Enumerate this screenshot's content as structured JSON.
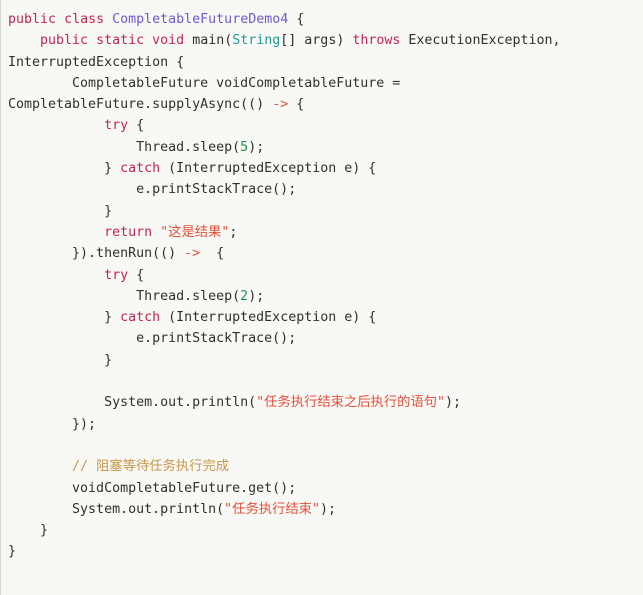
{
  "editor": {
    "language": "java",
    "background_color": "#f8f8f5",
    "left_border_color": "#d6d6d0",
    "default_text_color": "#303030",
    "font_size_px": 13.3,
    "line_height_px": 21.3
  },
  "syntax_colors": {
    "keyword": "#c7254e",
    "class_name": "#7158d6",
    "type": "#1f9e95",
    "number": "#1a9850",
    "string": "#e8503a",
    "comment": "#c8984b",
    "arrow": "#e8503a",
    "plain": "#303030"
  },
  "code": {
    "title": "CompletableFutureDemo4",
    "lines": [
      {
        "n": 1,
        "tokens": [
          {
            "t": "public",
            "c": "kw"
          },
          {
            "t": " "
          },
          {
            "t": "class",
            "c": "kw"
          },
          {
            "t": " "
          },
          {
            "t": "CompletableFutureDemo4",
            "c": "cls"
          },
          {
            "t": " {"
          }
        ]
      },
      {
        "n": 2,
        "tokens": [
          {
            "t": "    "
          },
          {
            "t": "public",
            "c": "kw"
          },
          {
            "t": " "
          },
          {
            "t": "static",
            "c": "kw"
          },
          {
            "t": " "
          },
          {
            "t": "void",
            "c": "kw"
          },
          {
            "t": " "
          },
          {
            "t": "main("
          },
          {
            "t": "String",
            "c": "typ"
          },
          {
            "t": "[] args) "
          },
          {
            "t": "throws",
            "c": "kw"
          },
          {
            "t": " ExecutionException,"
          }
        ]
      },
      {
        "n": 3,
        "tokens": [
          {
            "t": "InterruptedException {"
          }
        ]
      },
      {
        "n": 4,
        "tokens": [
          {
            "t": "        CompletableFuture voidCompletableFuture ="
          }
        ]
      },
      {
        "n": 5,
        "tokens": [
          {
            "t": "CompletableFuture.supplyAsync(() "
          },
          {
            "t": "->",
            "c": "arw"
          },
          {
            "t": " {"
          }
        ]
      },
      {
        "n": 6,
        "tokens": [
          {
            "t": "            "
          },
          {
            "t": "try",
            "c": "kw"
          },
          {
            "t": " {"
          }
        ]
      },
      {
        "n": 7,
        "tokens": [
          {
            "t": "                Thread.sleep("
          },
          {
            "t": "5",
            "c": "num"
          },
          {
            "t": ");"
          }
        ]
      },
      {
        "n": 8,
        "tokens": [
          {
            "t": "            } "
          },
          {
            "t": "catch",
            "c": "kw"
          },
          {
            "t": " (InterruptedException e) {"
          }
        ]
      },
      {
        "n": 9,
        "tokens": [
          {
            "t": "                e.printStackTrace();"
          }
        ]
      },
      {
        "n": 10,
        "tokens": [
          {
            "t": "            }"
          }
        ]
      },
      {
        "n": 11,
        "tokens": [
          {
            "t": "            "
          },
          {
            "t": "return",
            "c": "kw"
          },
          {
            "t": " "
          },
          {
            "t": "\"这是结果\"",
            "c": "str"
          },
          {
            "t": ";"
          }
        ]
      },
      {
        "n": 12,
        "tokens": [
          {
            "t": "        }).thenRun(() "
          },
          {
            "t": "->",
            "c": "arw"
          },
          {
            "t": "  {"
          }
        ]
      },
      {
        "n": 13,
        "tokens": [
          {
            "t": "            "
          },
          {
            "t": "try",
            "c": "kw"
          },
          {
            "t": " {"
          }
        ]
      },
      {
        "n": 14,
        "tokens": [
          {
            "t": "                Thread.sleep("
          },
          {
            "t": "2",
            "c": "num"
          },
          {
            "t": ");"
          }
        ]
      },
      {
        "n": 15,
        "tokens": [
          {
            "t": "            } "
          },
          {
            "t": "catch",
            "c": "kw"
          },
          {
            "t": " (InterruptedException e) {"
          }
        ]
      },
      {
        "n": 16,
        "tokens": [
          {
            "t": "                e.printStackTrace();"
          }
        ]
      },
      {
        "n": 17,
        "tokens": [
          {
            "t": "            }"
          }
        ]
      },
      {
        "n": 18,
        "tokens": []
      },
      {
        "n": 19,
        "tokens": [
          {
            "t": "            System.out.println("
          },
          {
            "t": "\"任务执行结束之后执行的语句\"",
            "c": "str"
          },
          {
            "t": ");"
          }
        ]
      },
      {
        "n": 20,
        "tokens": [
          {
            "t": "        });"
          }
        ]
      },
      {
        "n": 21,
        "tokens": []
      },
      {
        "n": 22,
        "tokens": [
          {
            "t": "        "
          },
          {
            "t": "// 阻塞等待任务执行完成",
            "c": "cmt"
          }
        ]
      },
      {
        "n": 23,
        "tokens": [
          {
            "t": "        voidCompletableFuture.get();"
          }
        ]
      },
      {
        "n": 24,
        "tokens": [
          {
            "t": "        System.out.println("
          },
          {
            "t": "\"任务执行结束\"",
            "c": "str"
          },
          {
            "t": ");"
          }
        ]
      },
      {
        "n": 25,
        "tokens": [
          {
            "t": "    }"
          }
        ]
      },
      {
        "n": 26,
        "tokens": [
          {
            "t": "}"
          }
        ]
      }
    ]
  }
}
